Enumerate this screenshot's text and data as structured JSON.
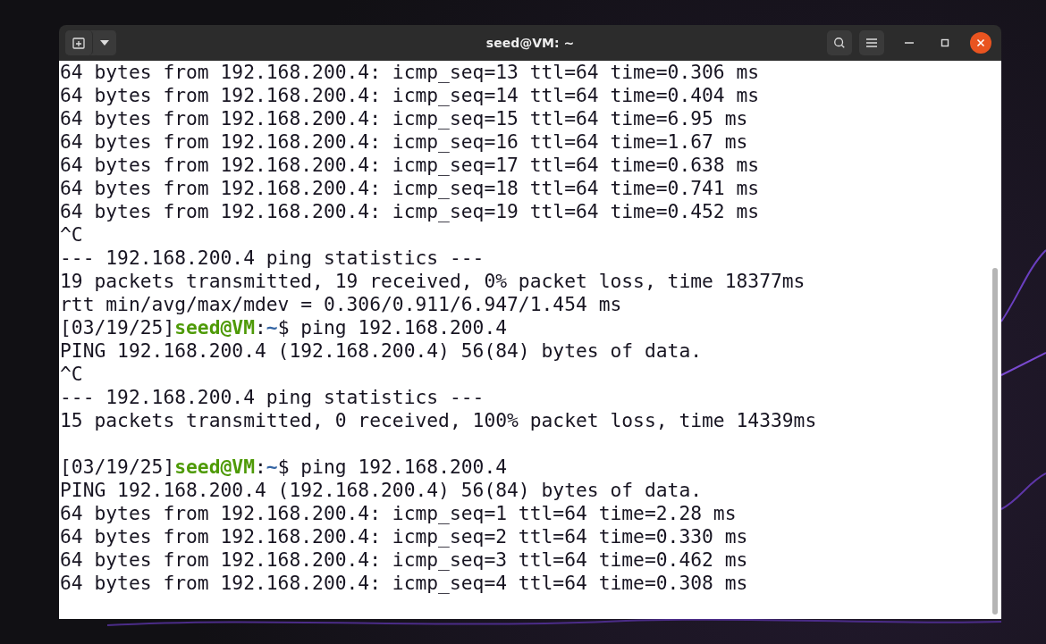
{
  "window": {
    "title": "seed@VM: ~"
  },
  "lines": [
    {
      "kind": "output",
      "text": "64 bytes from 192.168.200.4: icmp_seq=13 ttl=64 time=0.306 ms"
    },
    {
      "kind": "output",
      "text": "64 bytes from 192.168.200.4: icmp_seq=14 ttl=64 time=0.404 ms"
    },
    {
      "kind": "output",
      "text": "64 bytes from 192.168.200.4: icmp_seq=15 ttl=64 time=6.95 ms"
    },
    {
      "kind": "output",
      "text": "64 bytes from 192.168.200.4: icmp_seq=16 ttl=64 time=1.67 ms"
    },
    {
      "kind": "output",
      "text": "64 bytes from 192.168.200.4: icmp_seq=17 ttl=64 time=0.638 ms"
    },
    {
      "kind": "output",
      "text": "64 bytes from 192.168.200.4: icmp_seq=18 ttl=64 time=0.741 ms"
    },
    {
      "kind": "output",
      "text": "64 bytes from 192.168.200.4: icmp_seq=19 ttl=64 time=0.452 ms"
    },
    {
      "kind": "output",
      "text": "^C"
    },
    {
      "kind": "output",
      "text": "--- 192.168.200.4 ping statistics ---"
    },
    {
      "kind": "output",
      "text": "19 packets transmitted, 19 received, 0% packet loss, time 18377ms"
    },
    {
      "kind": "output",
      "text": "rtt min/avg/max/mdev = 0.306/0.911/6.947/1.454 ms"
    },
    {
      "kind": "prompt",
      "date": "[03/19/25]",
      "user_host": "seed@VM",
      "sep": ":",
      "path": "~",
      "command": "$ ping 192.168.200.4"
    },
    {
      "kind": "output",
      "text": "PING 192.168.200.4 (192.168.200.4) 56(84) bytes of data."
    },
    {
      "kind": "output",
      "text": "^C"
    },
    {
      "kind": "output",
      "text": "--- 192.168.200.4 ping statistics ---"
    },
    {
      "kind": "output",
      "text": "15 packets transmitted, 0 received, 100% packet loss, time 14339ms"
    },
    {
      "kind": "blank"
    },
    {
      "kind": "prompt",
      "date": "[03/19/25]",
      "user_host": "seed@VM",
      "sep": ":",
      "path": "~",
      "command": "$ ping 192.168.200.4"
    },
    {
      "kind": "output",
      "text": "PING 192.168.200.4 (192.168.200.4) 56(84) bytes of data."
    },
    {
      "kind": "output",
      "text": "64 bytes from 192.168.200.4: icmp_seq=1 ttl=64 time=2.28 ms"
    },
    {
      "kind": "output",
      "text": "64 bytes from 192.168.200.4: icmp_seq=2 ttl=64 time=0.330 ms"
    },
    {
      "kind": "output",
      "text": "64 bytes from 192.168.200.4: icmp_seq=3 ttl=64 time=0.462 ms"
    },
    {
      "kind": "output",
      "text": "64 bytes from 192.168.200.4: icmp_seq=4 ttl=64 time=0.308 ms"
    }
  ]
}
